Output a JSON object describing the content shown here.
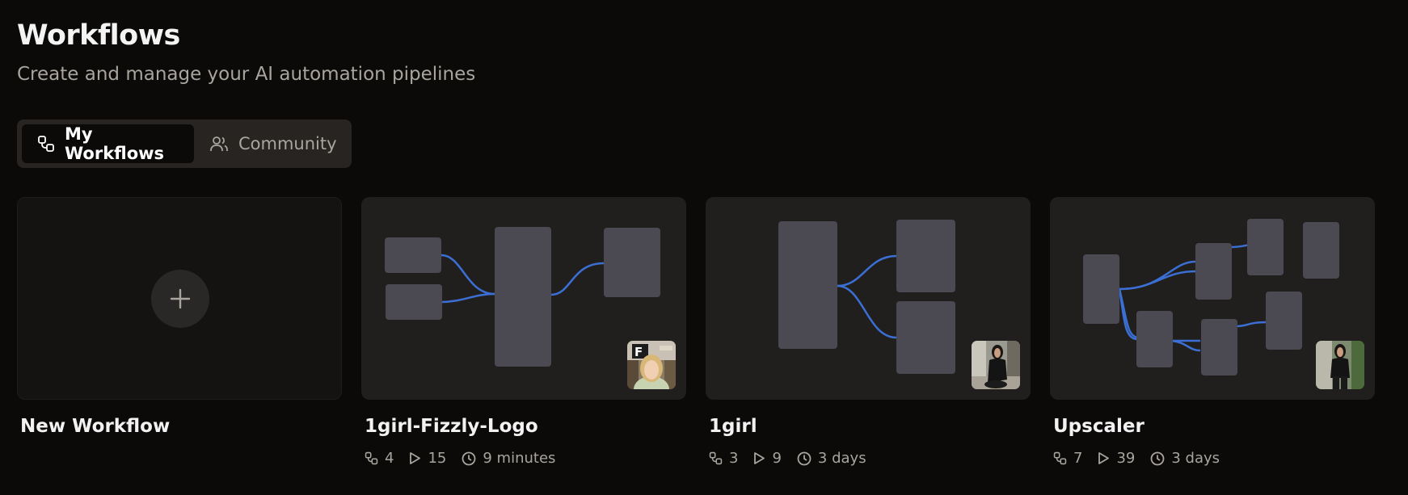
{
  "header": {
    "title": "Workflows",
    "subtitle": "Create and manage your AI automation pipelines"
  },
  "tabs": [
    {
      "label": "My Workflows",
      "icon": "workflow-icon",
      "active": true
    },
    {
      "label": "Community",
      "icon": "users-icon",
      "active": false
    }
  ],
  "new_card": {
    "label": "New Workflow",
    "icon": "plus-icon"
  },
  "workflows": [
    {
      "name": "1girl-Fizzly-Logo",
      "nodes": "4",
      "runs": "15",
      "updated": "9 minutes"
    },
    {
      "name": "1girl",
      "nodes": "3",
      "runs": "9",
      "updated": "3 days"
    },
    {
      "name": "Upscaler",
      "nodes": "7",
      "runs": "39",
      "updated": "3 days"
    }
  ],
  "colors": {
    "background": "#0b0a09",
    "card": "#211f1e",
    "node": "#4b4a52",
    "edge": "#3b6fd4",
    "muted_text": "#a8a49e"
  }
}
